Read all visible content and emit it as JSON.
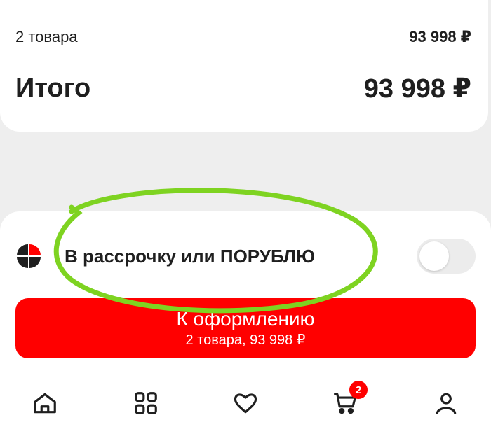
{
  "summary": {
    "items_label": "2 товара",
    "items_price": "93 998 ₽",
    "total_label": "Итого",
    "total_price": "93 998 ₽"
  },
  "installment": {
    "label": "В рассрочку или ПОРУБЛЮ",
    "toggle_on": false
  },
  "checkout_button": {
    "title": "К оформлению",
    "subtitle": "2 товара, 93 998 ₽"
  },
  "tab_bar": {
    "cart_badge": "2",
    "icons": [
      "home-icon",
      "catalog-icon",
      "favorites-icon",
      "cart-icon",
      "profile-icon"
    ]
  },
  "colors": {
    "accent": "#ff0000",
    "annotation": "#7ed321",
    "background": "#eeeeee"
  }
}
